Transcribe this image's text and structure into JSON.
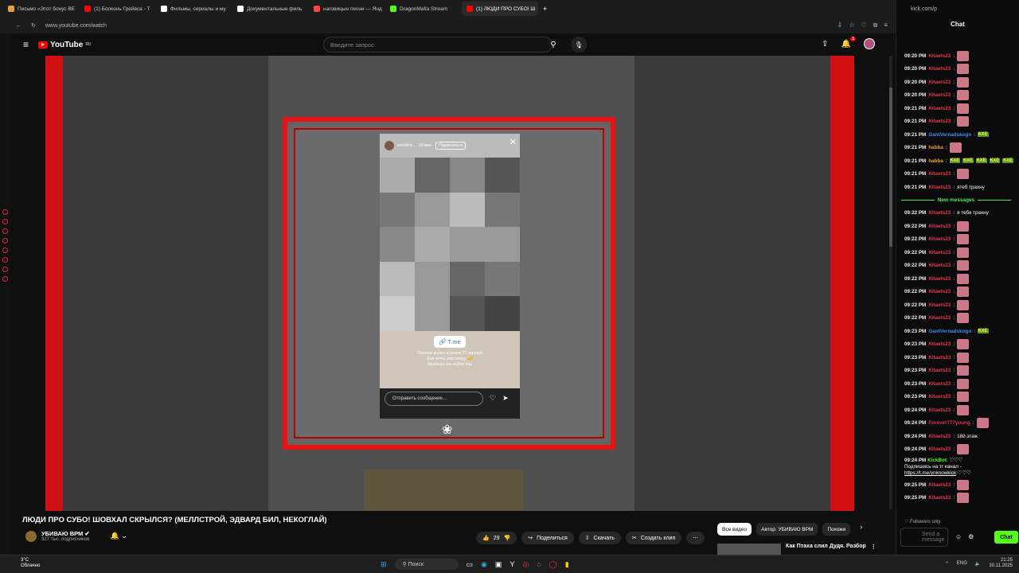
{
  "tabs": [
    {
      "label": "Письмо «Этот бонус ВЕ",
      "color": "#e8a03a"
    },
    {
      "label": "(1) Болезнь Грейвса - Т",
      "color": "#ff0000"
    },
    {
      "label": "Фильмы, сериалы и му",
      "color": "#ffffff"
    },
    {
      "label": "Документальные филь",
      "color": "#ffffff"
    },
    {
      "label": "наговицын песни — Янд",
      "color": "#f44"
    },
    {
      "label": "DragonMafia Stream",
      "color": "#53fc18"
    },
    {
      "label": "(1) ЛЮДИ ПРО СУБО! Ш",
      "color": "#ff0000"
    }
  ],
  "new_tab": "+",
  "address": "www.youtube.com/watch",
  "youtube": {
    "logo": "YouTube",
    "region": "RU",
    "search_placeholder": "Введите запрос",
    "notification_count": "1"
  },
  "story": {
    "username": "shovkha...",
    "time": "10 мин.",
    "subscribe": "Подписаться",
    "link_label": "T.me",
    "text_lines": [
      "Полное видео в моем ТГ канале",
      "Как есть расскажу 🤝",
      "Братиш на хайпе ты"
    ],
    "reply_placeholder": "Отправить сообщение..."
  },
  "video": {
    "title": "ЛЮДИ ПРО СУБО! ШОВХАЛ СКРЫЛСЯ? (МЕЛЛСТРОЙ, ЭДВАРД БИЛ, НЕКОГЛАЙ)",
    "channel": "УБИВАЮ ВРМ",
    "subscribers": "327 тыс. подписчиков",
    "likes": "29",
    "share": "Поделиться",
    "download": "Скачать",
    "clip": "Создать клип"
  },
  "chips": [
    "Все видео",
    "Автор: УБИВАЮ ВРМ",
    "Похожи"
  ],
  "recommended": {
    "title": "Как Птаха слил Дудя. Разбор"
  },
  "taskbar": {
    "temp": "3°C",
    "weather": "Облачно",
    "search": "Поиск",
    "lang": "ENG",
    "time": "21:25",
    "date": "30.11.2025"
  },
  "chat": {
    "url": "kick.com/p",
    "header": "Chat",
    "new_messages_label": "New messages",
    "messages": [
      {
        "time": "09:20 PM",
        "user": "Kitaets23",
        "color": "#e8344a",
        "text": ""
      },
      {
        "time": "09:20 PM",
        "user": "Kitaets23",
        "color": "#e8344a",
        "text": ""
      },
      {
        "time": "09:20 PM",
        "user": "Kitaets23",
        "color": "#e8344a",
        "text": ""
      },
      {
        "time": "09:20 PM",
        "user": "Kitaets23",
        "color": "#e8344a",
        "text": ""
      },
      {
        "time": "09:21 PM",
        "user": "Kitaets23",
        "color": "#e8344a",
        "text": ""
      },
      {
        "time": "09:21 PM",
        "user": "Kitaets23",
        "color": "#e8344a",
        "text": ""
      },
      {
        "time": "09:21 PM",
        "user": "GantVernadskogo",
        "color": "#3a8ff0",
        "text": "",
        "kxe": [
          "КХЕ"
        ]
      },
      {
        "time": "09:21 PM",
        "user": "habba",
        "color": "#f0a030",
        "text": ""
      },
      {
        "time": "09:21 PM",
        "user": "habba",
        "color": "#f0a030",
        "text": "",
        "kxe": [
          "КХЕ",
          "КХЕ",
          "КХЕ",
          "КХЕ",
          "КХЕ"
        ]
      },
      {
        "time": "09:21 PM",
        "user": "Kitaets23",
        "color": "#e8344a",
        "text": ""
      },
      {
        "time": "09:21 PM",
        "user": "Kitaets23",
        "color": "#e8344a",
        "text": "ятеб трахну"
      }
    ],
    "new_messages": [
      {
        "time": "09:22 PM",
        "user": "Kitaets23",
        "color": "#e8344a",
        "text": "я тебя трахну"
      },
      {
        "time": "09:22 PM",
        "user": "Kitaets23",
        "color": "#e8344a",
        "text": ""
      },
      {
        "time": "09:22 PM",
        "user": "Kitaets23",
        "color": "#e8344a",
        "text": ""
      },
      {
        "time": "09:22 PM",
        "user": "Kitaets23",
        "color": "#e8344a",
        "text": ""
      },
      {
        "time": "09:22 PM",
        "user": "Kitaets23",
        "color": "#e8344a",
        "text": ""
      },
      {
        "time": "09:22 PM",
        "user": "Kitaets23",
        "color": "#e8344a",
        "text": ""
      },
      {
        "time": "09:22 PM",
        "user": "Kitaets23",
        "color": "#e8344a",
        "text": ""
      },
      {
        "time": "09:22 PM",
        "user": "Kitaets23",
        "color": "#e8344a",
        "text": ""
      },
      {
        "time": "09:22 PM",
        "user": "Kitaets23",
        "color": "#e8344a",
        "text": ""
      },
      {
        "time": "09:23 PM",
        "user": "GantVernadskogo",
        "color": "#3a8ff0",
        "text": "",
        "kxe": [
          "КХЕ"
        ]
      },
      {
        "time": "09:23 PM",
        "user": "Kitaets23",
        "color": "#e8344a",
        "text": ""
      },
      {
        "time": "09:23 PM",
        "user": "Kitaets23",
        "color": "#e8344a",
        "text": ""
      },
      {
        "time": "09:23 PM",
        "user": "Kitaets23",
        "color": "#e8344a",
        "text": ""
      },
      {
        "time": "09:23 PM",
        "user": "Kitaets23",
        "color": "#e8344a",
        "text": ""
      },
      {
        "time": "09:23 PM",
        "user": "Kitaets23",
        "color": "#e8344a",
        "text": ""
      },
      {
        "time": "09:24 PM",
        "user": "Kitaets23",
        "color": "#e8344a",
        "text": ""
      },
      {
        "time": "09:24 PM",
        "user": "Forever777young",
        "color": "#e8344a",
        "text": ""
      },
      {
        "time": "09:24 PM",
        "user": "Kitaets23",
        "color": "#e8344a",
        "text": "18й этаж"
      },
      {
        "time": "09:24 PM",
        "user": "Kitaets23",
        "color": "#e8344a",
        "text": ""
      }
    ],
    "kickbot": {
      "time": "09:24 PM",
      "user": "KickBot",
      "text": "Подпишись на тг канал -",
      "link": "https://t.me/ynknowkick",
      "hearts": "♡♡♡"
    },
    "tail_messages": [
      {
        "time": "09:25 PM",
        "user": "Kitaets23",
        "color": "#e8344a",
        "text": ""
      },
      {
        "time": "09:25 PM",
        "user": "Kitaets23",
        "color": "#e8344a",
        "text": ""
      }
    ],
    "followers_only": "Followers only",
    "input_placeholder": "Send a message",
    "send_button": "Chat"
  }
}
